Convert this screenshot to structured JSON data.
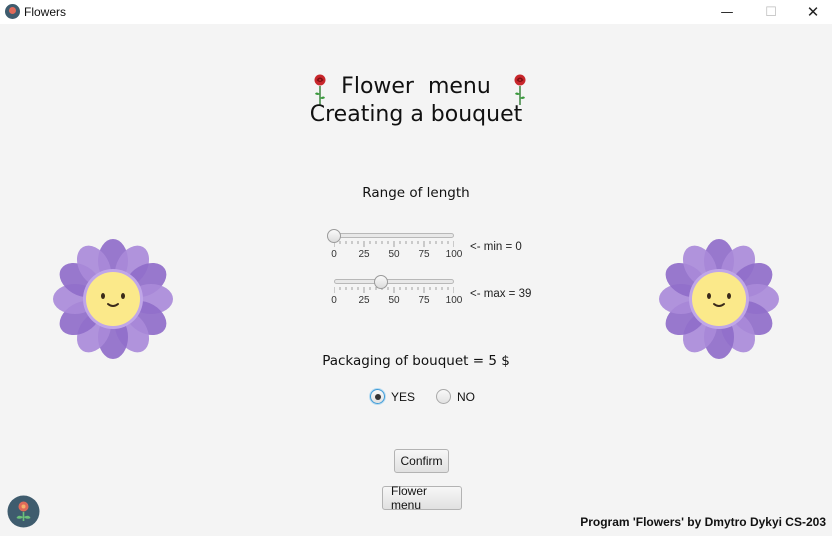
{
  "window": {
    "title": "Flowers",
    "minimize_glyph": "—",
    "maximize_glyph": "☐",
    "close_glyph": "✕"
  },
  "header": {
    "line1": "Flower  menu",
    "line2": "Creating a bouquet"
  },
  "length": {
    "label": "Range of length",
    "ticks": [
      "0",
      "25",
      "50",
      "75",
      "100"
    ],
    "min_value": 0,
    "max_value": 39,
    "min_text": "<- min = 0",
    "max_text": "<- max = 39"
  },
  "packaging": {
    "label": "Packaging of bouquet = 5 $",
    "options": [
      {
        "label": "YES",
        "selected": true
      },
      {
        "label": "NO",
        "selected": false
      }
    ]
  },
  "buttons": {
    "confirm": "Confirm",
    "flower_menu": "Flower menu"
  },
  "footer": {
    "credit": "Program 'Flowers' by Dmytro Dykyi CS-203"
  },
  "colors": {
    "petal": "#a98ad9",
    "petal_dark": "#8f6cc9",
    "flower_center": "#fbe98a",
    "rose": "#c8262b",
    "accent": "#3c9ad6"
  },
  "icons": {
    "app": "flower-logo-icon",
    "decor": "smiling-flower-icon",
    "heading": "rose-icon"
  }
}
